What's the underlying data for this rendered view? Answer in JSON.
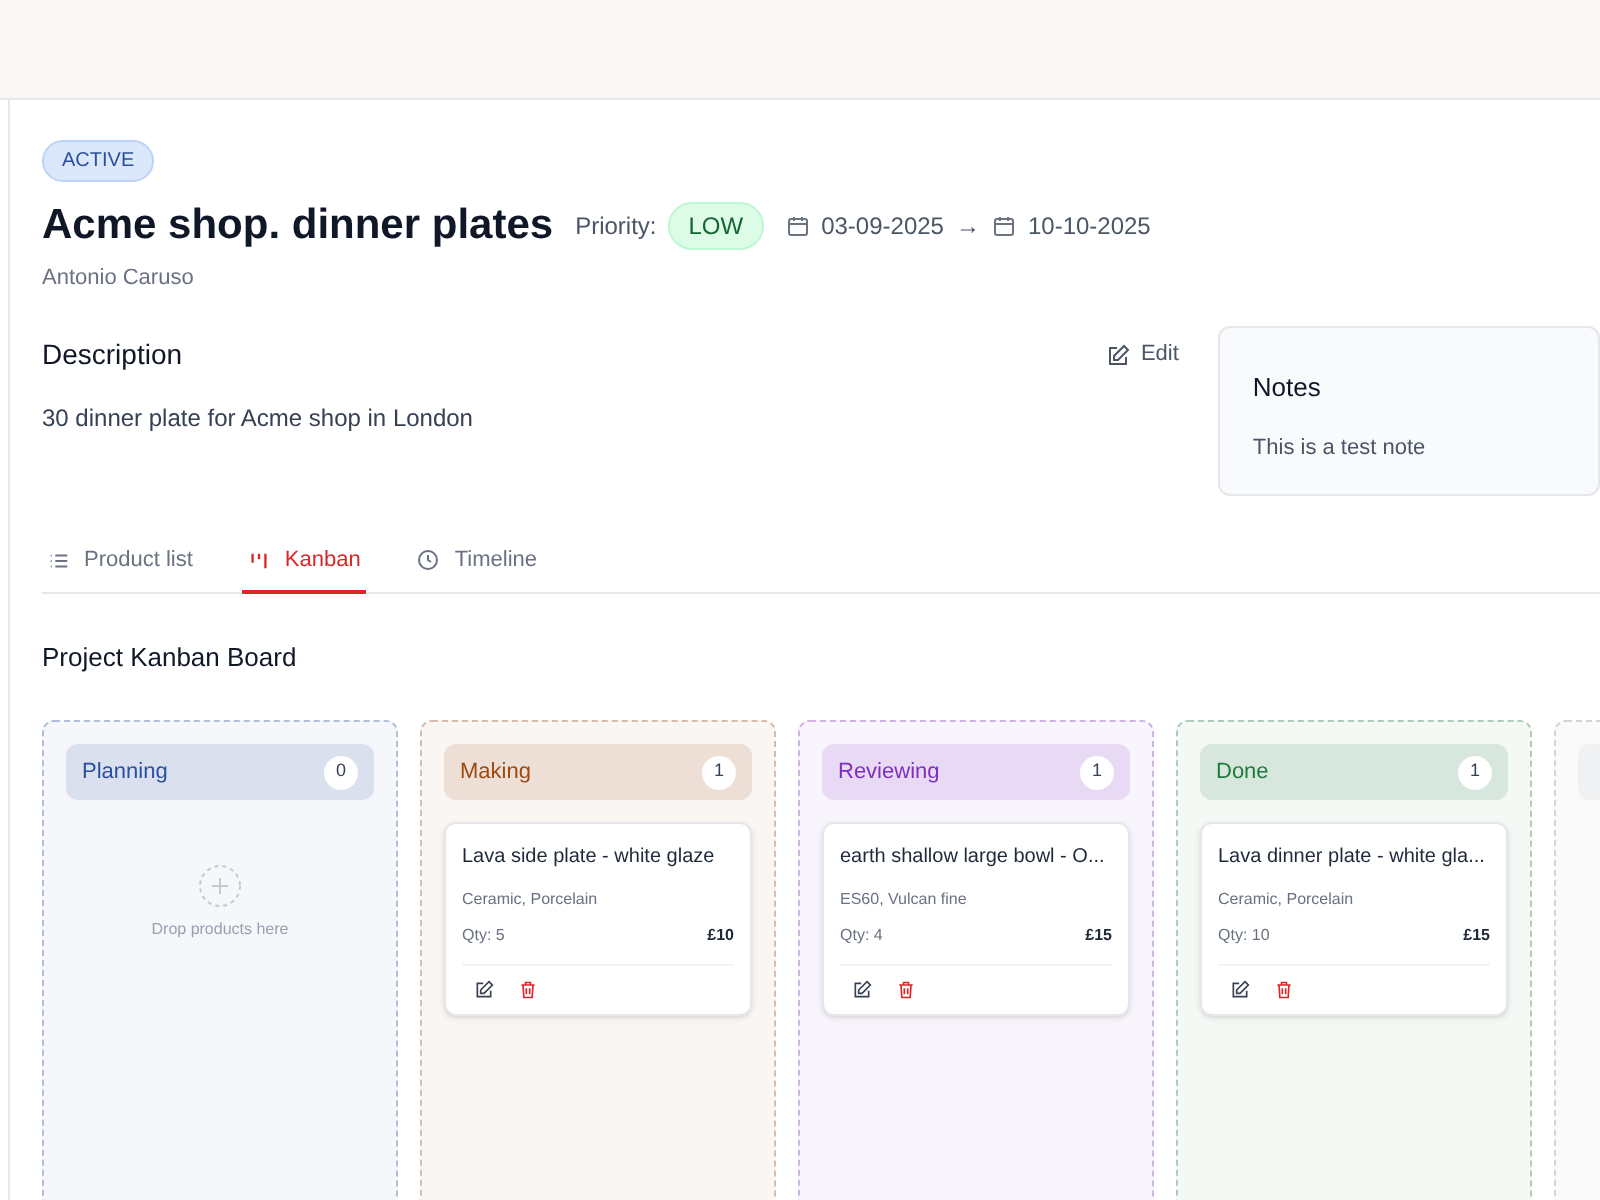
{
  "project": {
    "status": "ACTIVE",
    "title": "Acme shop. dinner plates",
    "priority_label": "Priority:",
    "priority": "LOW",
    "start_date": "03-09-2025",
    "arrow": "→",
    "end_date": "10-10-2025",
    "owner": "Antonio Caruso"
  },
  "description": {
    "heading": "Description",
    "edit": "Edit",
    "text": "30 dinner plate for Acme shop in London"
  },
  "notes": {
    "heading": "Notes",
    "text": "This is a test note"
  },
  "tabs": [
    {
      "label": "Product list",
      "kind": "list",
      "selected": false
    },
    {
      "label": "Kanban",
      "kind": "kanban",
      "selected": true
    },
    {
      "label": "Timeline",
      "kind": "clock",
      "selected": false
    }
  ],
  "board": {
    "title": "Project Kanban Board",
    "empty_hint": "Drop products here",
    "columns": [
      {
        "title": "Planning",
        "count": "0",
        "color": "#2b4ea0"
      },
      {
        "title": "Making",
        "count": "1",
        "color": "#9a4a12",
        "cards": [
          {
            "name": "Lava side plate - white glaze",
            "materials": "Ceramic, Porcelain",
            "qty": "Qty: 5",
            "price": "£10"
          }
        ]
      },
      {
        "title": "Reviewing",
        "count": "1",
        "color": "#7e2fc0",
        "cards": [
          {
            "name": "earth shallow large bowl - O...",
            "materials": "ES60, Vulcan fine",
            "qty": "Qty: 4",
            "price": "£15"
          }
        ]
      },
      {
        "title": "Done",
        "count": "1",
        "color": "#1f7a3e",
        "cards": [
          {
            "name": "Lava dinner plate - white gla...",
            "materials": "Ceramic, Porcelain",
            "qty": "Qty: 10",
            "price": "£15"
          }
        ]
      },
      {
        "color": "#f0f1f3"
      }
    ]
  }
}
